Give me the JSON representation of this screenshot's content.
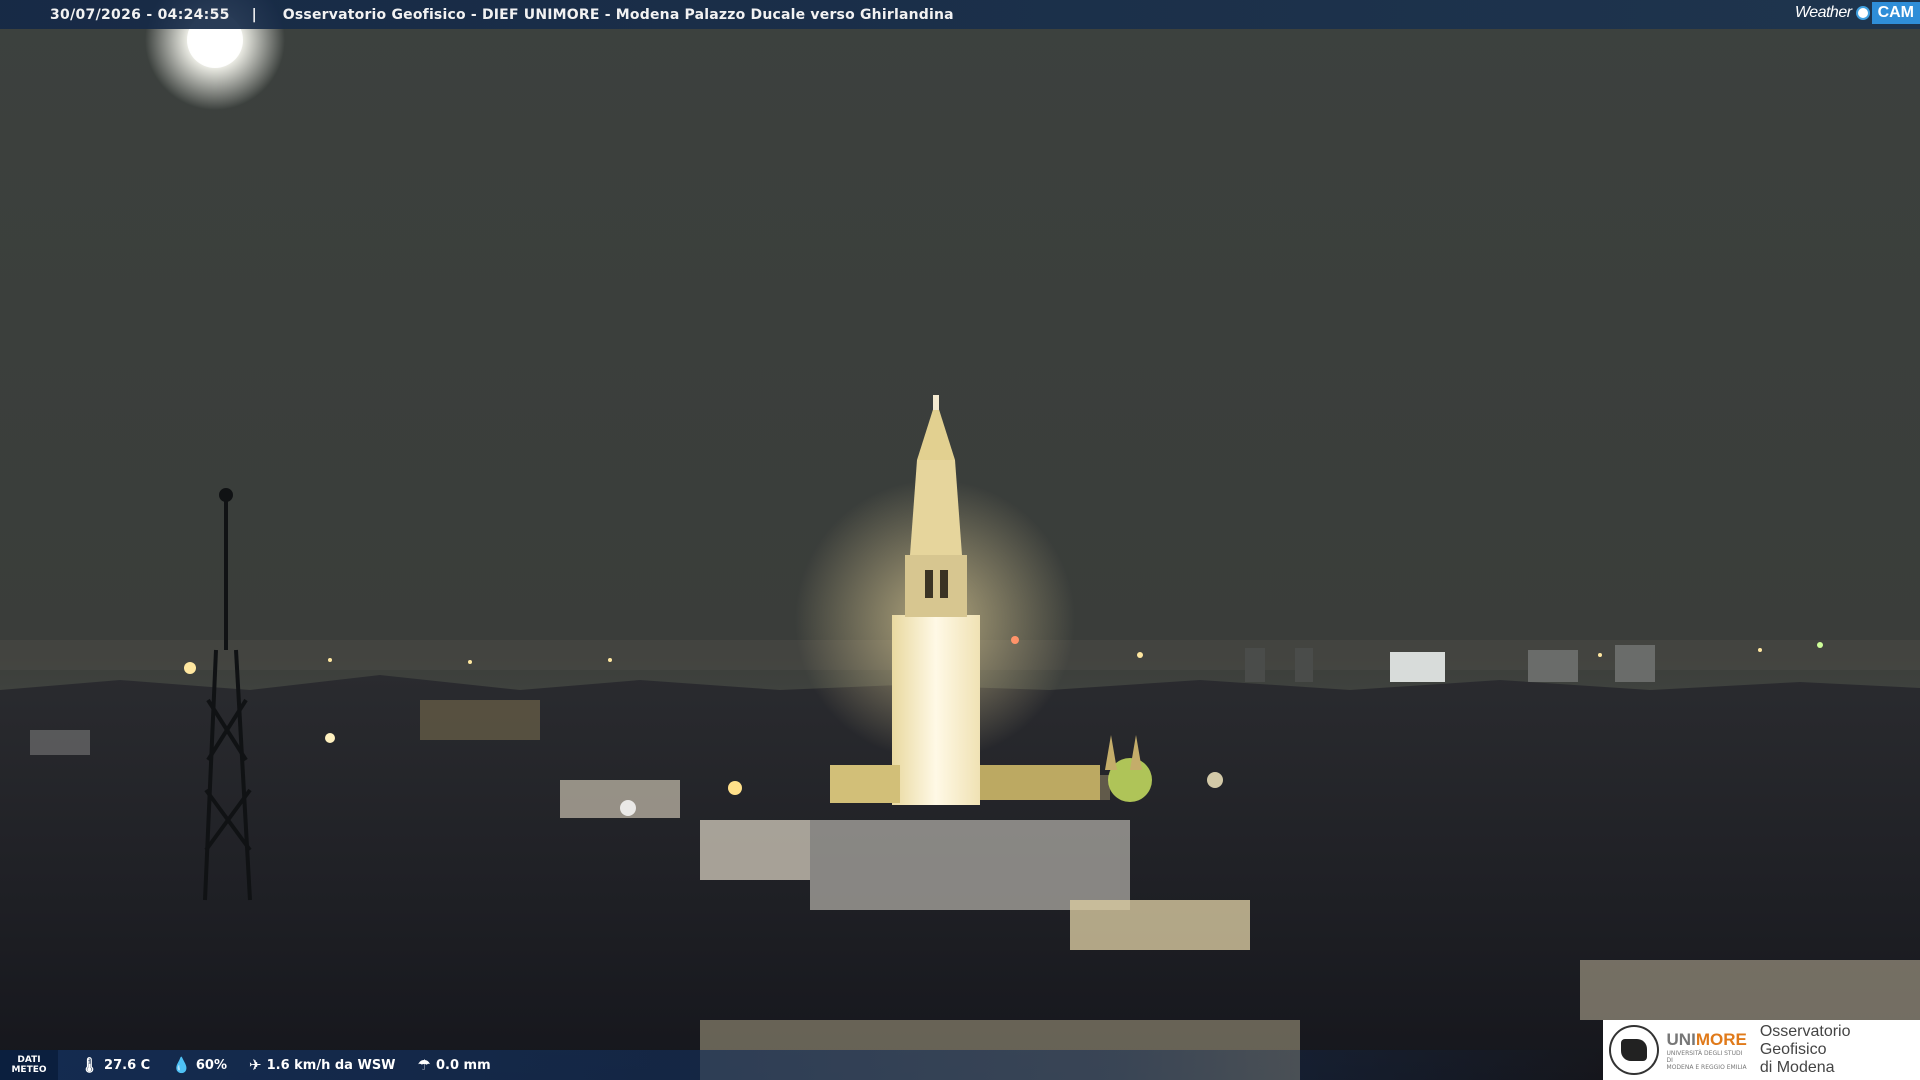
{
  "overlay": {
    "timestamp": "30/07/2026 - 04:24:55",
    "separator": "|",
    "camera_title": "Osservatorio Geofisico - DIEF UNIMORE - Modena Palazzo Ducale verso Ghirlandina",
    "brand_weather": "Weather",
    "brand_cam": "CAM"
  },
  "weather": {
    "label_line1": "DATI",
    "label_line2": "METEO",
    "temperature": "27.6 C",
    "humidity": "60%",
    "wind": "1.6 km/h da WSW",
    "rain": "0.0 mm",
    "icons": [
      "thermometer-icon",
      "drop-icon",
      "wind-icon",
      "rain-icon"
    ]
  },
  "logo": {
    "uni": "UNI",
    "more": "MORE",
    "uni_sub_line1": "UNIVERSITÀ DEGLI STUDI DI",
    "uni_sub_line2": "MODENA E REGGIO EMILIA",
    "obs_line1": "Osservatorio Geofisico",
    "obs_line2": "di Modena"
  },
  "colors": {
    "sky": "#3a3f3c",
    "tower_light": "#fff6d8",
    "city_dark": "#1b1d24",
    "bar_blue": "#1e3a66",
    "brand_blue": "#2f8ed8",
    "more_orange": "#e07a1a"
  }
}
